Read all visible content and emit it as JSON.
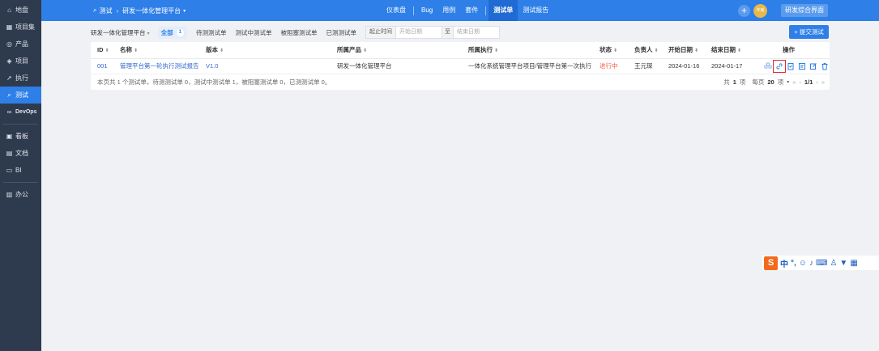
{
  "sidebar": {
    "items": [
      {
        "label": "地盘",
        "icon": "home-icon"
      },
      {
        "label": "项目集",
        "icon": "program-icon"
      },
      {
        "label": "产品",
        "icon": "product-icon"
      },
      {
        "label": "项目",
        "icon": "project-icon"
      },
      {
        "label": "执行",
        "icon": "execution-icon"
      },
      {
        "label": "测试",
        "icon": "test-icon",
        "active": true
      },
      {
        "label": "DevOps",
        "icon": "devops-icon"
      },
      {
        "label": "看板",
        "icon": "kanban-icon"
      },
      {
        "label": "文档",
        "icon": "doc-icon"
      },
      {
        "label": "BI",
        "icon": "bi-icon"
      },
      {
        "label": "办公",
        "icon": "office-icon"
      }
    ]
  },
  "header": {
    "module": "测试",
    "product": "研发一体化管理平台",
    "nav": [
      "仪表盘",
      "Bug",
      "用例",
      "套件",
      "测试单",
      "测试报告"
    ],
    "active_nav": "测试单",
    "avatar_text": "作威",
    "workspace_button": "研发综合界面"
  },
  "toolbar": {
    "product_select": "研发一体化管理平台",
    "tabs": [
      {
        "label": "全部",
        "count": "1"
      },
      {
        "label": "待测测试单"
      },
      {
        "label": "测试中测试单"
      },
      {
        "label": "被阻塞测试单"
      },
      {
        "label": "已测测试单"
      }
    ],
    "date_label": "起止时间",
    "start_placeholder": "开始日期",
    "date_sep": "至",
    "end_placeholder": "结束日期",
    "submit_label": "+ 提交测试"
  },
  "table": {
    "columns": [
      "ID",
      "名称",
      "版本",
      "所属产品",
      "所属执行",
      "状态",
      "负责人",
      "开始日期",
      "结束日期",
      "操作"
    ],
    "rows": [
      {
        "id": "001",
        "name": "管理平台第一轮执行测试报告",
        "version": "V1.0",
        "product": "研发一体化管理平台",
        "execution": "一体化系统管理平台项目/管理平台第一次执行",
        "status": "进行中",
        "owner": "王元琛",
        "start": "2024-01-16",
        "end": "2024-01-17"
      }
    ],
    "summary": "本页共 1 个测试单，待测测试单 0，测试中测试单 1，被阻塞测试单 0，已测测试单 0。",
    "pager": {
      "total_prefix": "共",
      "total": "1",
      "total_suffix": "项",
      "per_page_label": "每页",
      "per_page": "20",
      "per_page_suffix": "项",
      "page": "1/1"
    }
  },
  "ime": {
    "label": "中"
  }
}
